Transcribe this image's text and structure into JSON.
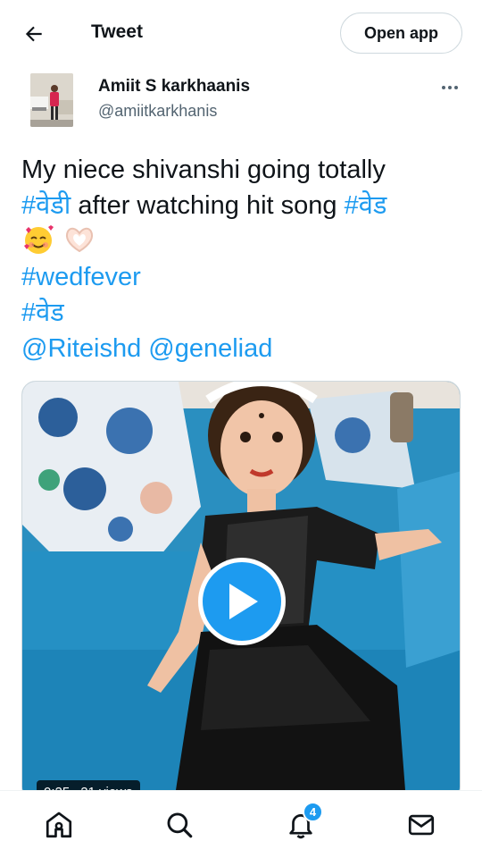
{
  "header": {
    "title": "Tweet",
    "open_app_label": "Open app"
  },
  "author": {
    "name": "Amiit S karkhaanis",
    "handle": "@amiitkarkhanis"
  },
  "tweet": {
    "line1": "My niece shivanshi going totally",
    "hashtag_vedi": "#वेडी",
    "line2_mid": " after watching hit song ",
    "hashtag_ved": "#वेड",
    "hashtag_wedfever": "#wedfever",
    "hashtag_ved2": "#वेड",
    "mention_riteish": "@Riteishd",
    "mention_genelia": "@geneliad",
    "emojis": [
      "smiling-face-with-hearts",
      "heart-hands"
    ]
  },
  "media": {
    "duration": "0:25",
    "views": "21 views"
  },
  "bottom_nav": {
    "items": [
      "home-icon",
      "search-icon",
      "notifications-icon",
      "messages-icon"
    ],
    "notifications_count": "4"
  },
  "colors": {
    "accent": "#1d9bf0",
    "text": "#0f1419",
    "muted": "#536471"
  }
}
